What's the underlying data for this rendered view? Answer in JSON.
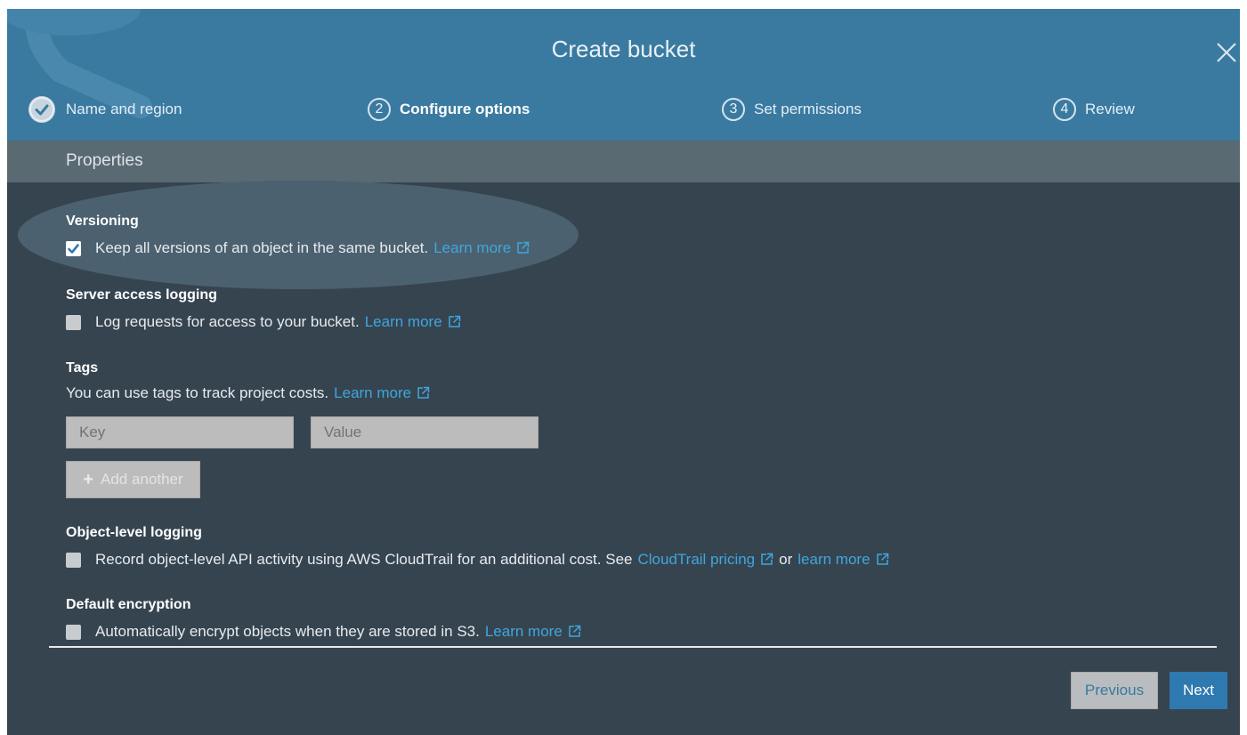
{
  "modal": {
    "title": "Create bucket"
  },
  "steps": [
    {
      "number": "",
      "label": "Name and region",
      "state": "done"
    },
    {
      "number": "2",
      "label": "Configure options",
      "state": "active"
    },
    {
      "number": "3",
      "label": "Set permissions",
      "state": "pending"
    },
    {
      "number": "4",
      "label": "Review",
      "state": "pending"
    }
  ],
  "section": {
    "title": "Properties"
  },
  "versioning": {
    "title": "Versioning",
    "checked": true,
    "text": "Keep all versions of an object in the same bucket.",
    "link": "Learn more"
  },
  "server_access_logging": {
    "title": "Server access logging",
    "checked": false,
    "text": "Log requests for access to your bucket.",
    "link": "Learn more"
  },
  "tags": {
    "title": "Tags",
    "text": "You can use tags to track project costs.",
    "link": "Learn more",
    "key_placeholder": "Key",
    "value_placeholder": "Value",
    "add_label": "Add another"
  },
  "object_level_logging": {
    "title": "Object-level logging",
    "checked": false,
    "text": "Record object-level API activity using AWS CloudTrail for an additional cost. See",
    "link1": "CloudTrail pricing",
    "connector": "or",
    "link2": "learn more"
  },
  "default_encryption": {
    "title": "Default encryption",
    "checked": false,
    "text": "Automatically encrypt objects when they are stored in S3.",
    "link": "Learn more"
  },
  "footer": {
    "previous_label": "Previous",
    "next_label": "Next"
  },
  "colors": {
    "header": "#3a7aa0",
    "body": "#364450",
    "link": "#3fa6dd",
    "primary_button": "#2e7ab0"
  },
  "icons": {
    "close": "close-icon",
    "step_done": "check-circle-icon",
    "external": "external-link-icon",
    "checkbox_checked": "check-icon",
    "add": "plus-icon"
  }
}
